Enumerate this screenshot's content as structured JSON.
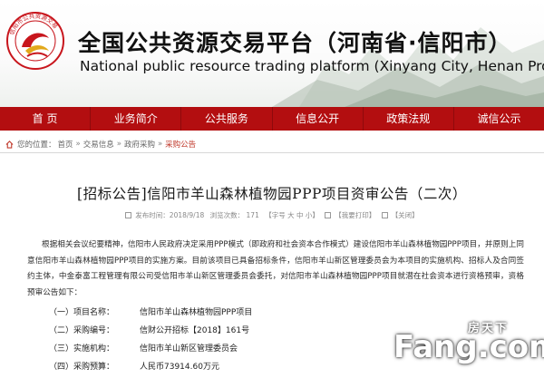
{
  "header": {
    "logo_text": "信阳市公共资源交易",
    "title_cn": "全国公共资源交易平台（河南省·信阳市）",
    "title_en": "National public resource trading platform (Xinyang City, Henan Province)"
  },
  "nav": {
    "items": [
      "首 页",
      "业务简介",
      "公共服务",
      "信息公开",
      "政策法规",
      "诚信公示"
    ]
  },
  "breadcrumb": {
    "prefix": "您的位置：",
    "items": [
      "首页",
      "交易信息",
      "政府采购",
      "采购公告"
    ]
  },
  "article": {
    "title": "[招标公告]信阳市羊山森林植物园PPP项目资审公告（二次）",
    "meta": {
      "date": "发布时间：2018/9/18",
      "views": "浏览次数：  171",
      "font_size": "【字号 大 中 小】",
      "print": "【我要打印】",
      "close": "【关闭】"
    },
    "paragraph": "根据相关会议纪要精神，信阳市人民政府决定采用PPP模式（即政府和社会资本合作模式）建设信阳市羊山森林植物园PPP项目，并原则上同意信阳市羊山森林植物园PPP项目的实施方案。目前该项目已具备招标条件，信阳市羊山新区管理委员会为本项目的实施机构、招标人及合同签约主体，中金泰富工程管理有限公司受信阳市羊山新区管理委员会委托，对信阳市羊山森林植物园PPP项目就潜在社会资本进行资格预审，资格预审公告如下：",
    "info": [
      {
        "label": "（一）项目名称：",
        "value": "信阳市羊山森林植物园PPP项目"
      },
      {
        "label": "（二）采购编号：",
        "value": "信财公开招标【2018】161号"
      },
      {
        "label": "（三）实施机构：",
        "value": "信阳市羊山新区管理委员会"
      },
      {
        "label": "（四）采购预算：",
        "value": "人民币73914.60万元"
      }
    ]
  },
  "watermark": {
    "cn": "房天下",
    "en": "Fang.com"
  },
  "colors": {
    "nav_bg": "#b30e10",
    "logo_red": "#c8161d",
    "logo_gold": "#e2a81b",
    "breadcrumb_current": "#c0392b"
  }
}
